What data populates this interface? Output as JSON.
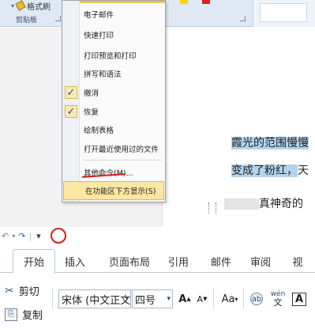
{
  "ribbon_top": {
    "format_painter_label": "格式刷",
    "clipboard_group_label": "剪贴板"
  },
  "menu": {
    "items": [
      {
        "label": "电子邮件",
        "checked": false
      },
      {
        "label": "快速打印",
        "checked": false
      },
      {
        "label": "打印预览和打印",
        "checked": false
      },
      {
        "label": "拼写和语法",
        "checked": false
      },
      {
        "label": "撤消",
        "checked": true
      },
      {
        "label": "恢复",
        "checked": true
      },
      {
        "label": "绘制表格",
        "checked": false
      },
      {
        "label": "打开最近使用过的文件",
        "checked": false
      },
      {
        "label": "其他命令(M)...",
        "checked": false
      },
      {
        "label": "在功能区下方显示(S)",
        "checked": false
      }
    ],
    "check_glyph": "✓"
  },
  "document": {
    "line1": "霞光的范围慢慢",
    "line2": "变成了粉红，",
    "line2_tail": "天",
    "line3_tail": "真神奇的"
  },
  "quick_access": {
    "undo_glyph": "↶",
    "redo_glyph": "↷",
    "customize_glyph": "▾"
  },
  "tabs": [
    "开始",
    "插入",
    "页面布局",
    "引用",
    "邮件",
    "审阅",
    "视"
  ],
  "active_tab": "开始",
  "clipboard": {
    "cut_label": "剪切",
    "copy_label": "复制"
  },
  "font": {
    "name": "宋体 (中文正文",
    "size": "四号",
    "grow_label": "A",
    "shrink_label": "A",
    "case_label": "Aa",
    "phonetic_label": "wén",
    "border_label": "A"
  },
  "colors": {
    "accent_blue": "#1d5aab",
    "highlight": "#b3d3ec",
    "menu_hot": "#fbe6a3",
    "annotation_red": "#d81c1c"
  }
}
